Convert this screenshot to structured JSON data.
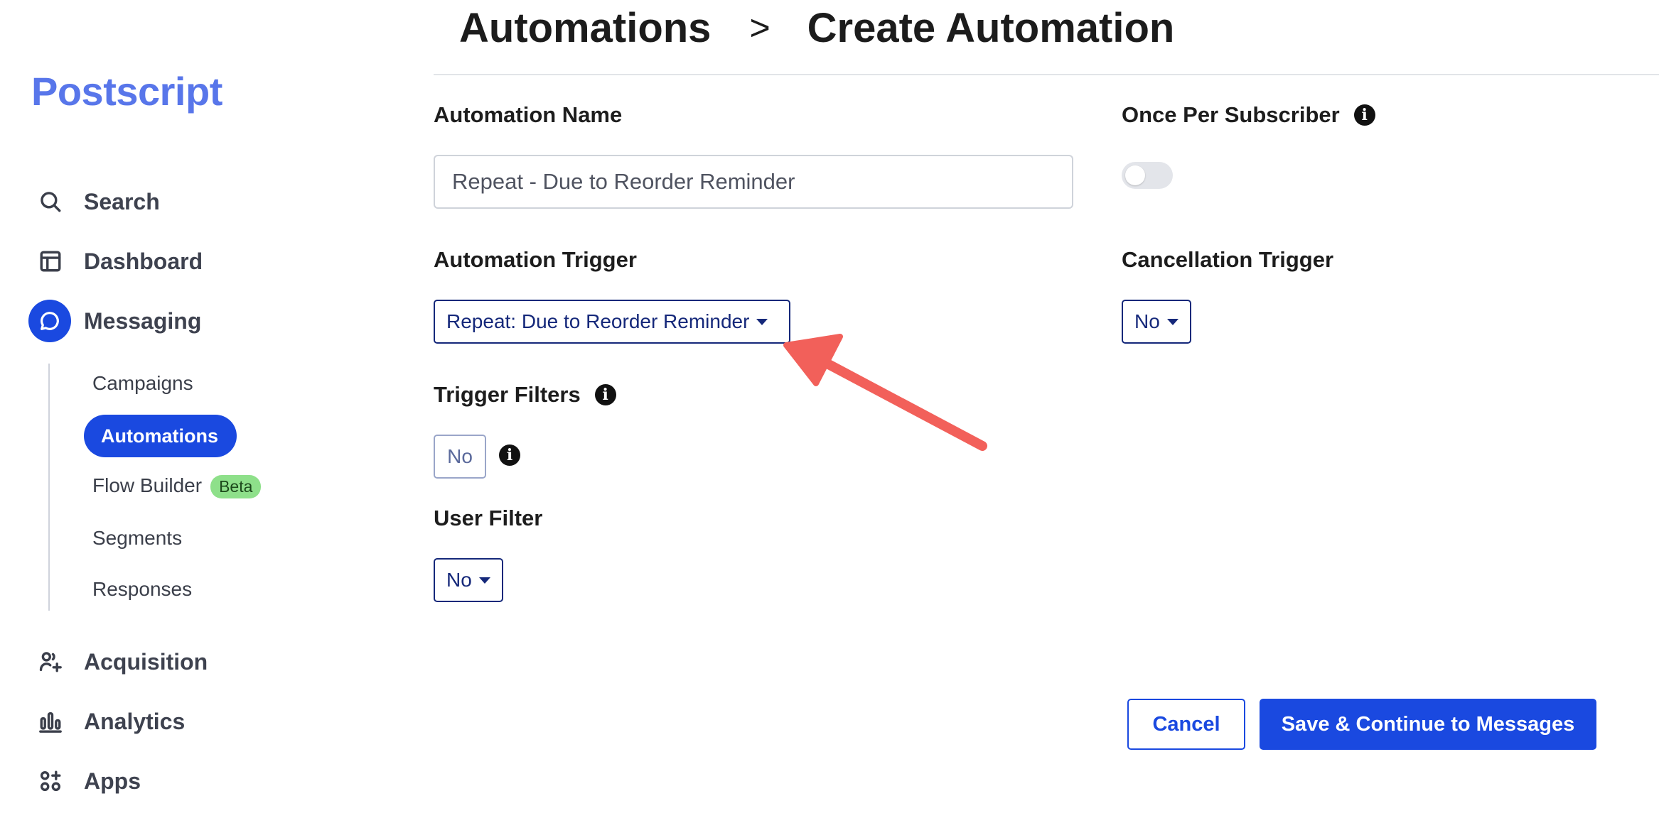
{
  "brand": {
    "logo_text": "Postscript",
    "logo_color": "#5876ea"
  },
  "colors": {
    "primary": "#1a49e0",
    "dropdown_text": "#15287a",
    "beta_badge": "#8ee08a",
    "annotation_arrow": "#f2605a"
  },
  "sidebar": {
    "items": [
      {
        "label": "Search",
        "icon": "search-icon"
      },
      {
        "label": "Dashboard",
        "icon": "dashboard-icon"
      },
      {
        "label": "Messaging",
        "icon": "chat-bubble-icon",
        "active": true
      },
      {
        "label": "Acquisition",
        "icon": "user-add-icon"
      },
      {
        "label": "Analytics",
        "icon": "bar-chart-icon"
      },
      {
        "label": "Apps",
        "icon": "apps-grid-icon"
      }
    ],
    "messaging_subitems": [
      {
        "label": "Campaigns"
      },
      {
        "label": "Automations",
        "active": true
      },
      {
        "label": "Flow Builder",
        "badge": "Beta"
      },
      {
        "label": "Segments"
      },
      {
        "label": "Responses"
      }
    ]
  },
  "header": {
    "breadcrumb_parent": "Automations",
    "breadcrumb_separator": ">",
    "breadcrumb_current": "Create Automation"
  },
  "form": {
    "automation_name_label": "Automation Name",
    "automation_name_value": "Repeat - Due to Reorder Reminder",
    "once_per_subscriber_label": "Once Per Subscriber",
    "once_per_subscriber_enabled": false,
    "automation_trigger_label": "Automation Trigger",
    "automation_trigger_value": "Repeat: Due to Reorder Reminder",
    "cancellation_trigger_label": "Cancellation Trigger",
    "cancellation_trigger_value": "No",
    "trigger_filters_label": "Trigger Filters",
    "trigger_filters_value": "No",
    "user_filter_label": "User Filter",
    "user_filter_value": "No"
  },
  "actions": {
    "cancel_label": "Cancel",
    "save_label": "Save & Continue to Messages"
  }
}
